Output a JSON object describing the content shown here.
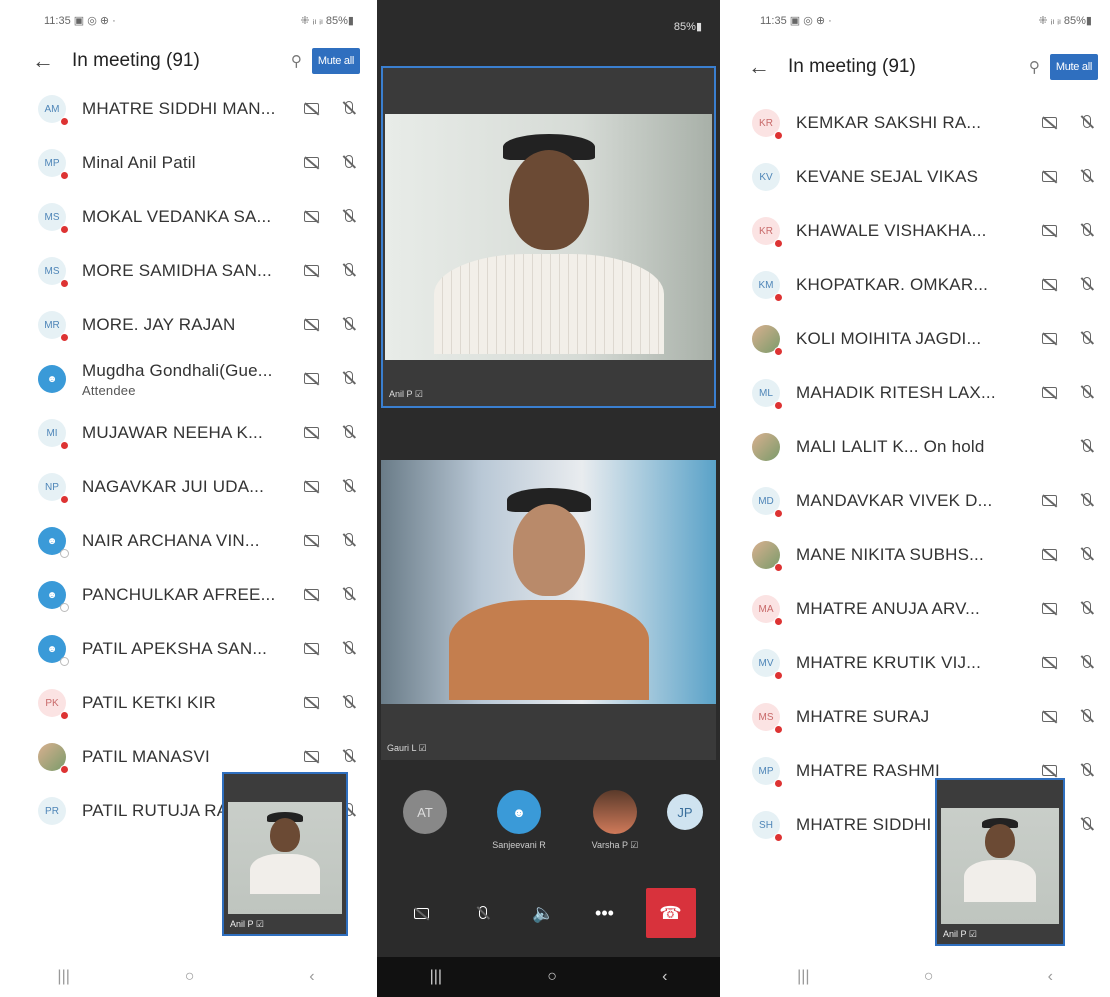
{
  "left": {
    "status": {
      "time": "11:35 ▣ ◎ ⊕ ·",
      "right": "⁜ ᵢₗ ᵢₗ 85%▮"
    },
    "header": {
      "back": "←",
      "title": "In meeting (91)",
      "mute_all": "Mute all"
    },
    "participants": [
      {
        "initials": "AM",
        "name": "MHATRE SIDDHI MAN...",
        "style": "",
        "dot": "red"
      },
      {
        "initials": "MP",
        "name": "Minal Anil Patil",
        "style": "",
        "dot": "red"
      },
      {
        "initials": "MS",
        "name": "MOKAL VEDANKA SA...",
        "style": "",
        "dot": "red"
      },
      {
        "initials": "MS",
        "name": "MORE SAMIDHA SAN...",
        "style": "",
        "dot": "red"
      },
      {
        "initials": "MR",
        "name": "MORE. JAY RAJAN",
        "style": "",
        "dot": "red"
      },
      {
        "initials": "",
        "name": "Mugdha Gondhali(Gue...",
        "sub": "Attendee",
        "style": "blue",
        "dot": ""
      },
      {
        "initials": "MI",
        "name": "MUJAWAR NEEHA K...",
        "style": "",
        "dot": "red"
      },
      {
        "initials": "NP",
        "name": "NAGAVKAR JUI UDA...",
        "style": "",
        "dot": "red"
      },
      {
        "initials": "",
        "name": "NAIR ARCHANA VIN...",
        "style": "blue",
        "dot": "hollow"
      },
      {
        "initials": "",
        "name": "PANCHULKAR AFREE...",
        "style": "blue",
        "dot": "hollow"
      },
      {
        "initials": "",
        "name": "PATIL APEKSHA SAN...",
        "style": "blue",
        "dot": "hollow"
      },
      {
        "initials": "PK",
        "name": "PATIL KETKI KIR",
        "style": "pink",
        "dot": "red"
      },
      {
        "initials": "",
        "name": "PATIL MANASVI",
        "style": "photo",
        "dot": "red"
      },
      {
        "initials": "PR",
        "name": "PATIL RUTUJA RAVI...",
        "style": "",
        "dot": ""
      }
    ],
    "pip_label": "Anil P ☑"
  },
  "middle": {
    "status": "85%▮",
    "video1_label": "Anil P ☑",
    "video2_label": "Gauri L ☑",
    "thumbs": [
      {
        "text": "AT",
        "label": ""
      },
      {
        "text": "",
        "label": "Sanjeevani R"
      },
      {
        "text": "",
        "label": "Varsha P ☑"
      },
      {
        "text": "JP",
        "label": ""
      }
    ],
    "controls": {
      "video": "◘",
      "mic": "🎙",
      "speaker": "🔈",
      "more": "•••",
      "hangup": "☎"
    }
  },
  "right": {
    "status": {
      "time": "11:35 ▣ ◎ ⊕ ·",
      "right": "⁜ ᵢₗ ᵢₗ 85%▮"
    },
    "header": {
      "back": "←",
      "title": "In meeting (91)",
      "mute_all": "Mute all"
    },
    "participants": [
      {
        "initials": "KR",
        "name": "KEMKAR SAKSHI RA...",
        "style": "pink",
        "dot": "red"
      },
      {
        "initials": "KV",
        "name": "KEVANE SEJAL VIKAS",
        "style": "",
        "dot": ""
      },
      {
        "initials": "KR",
        "name": "KHAWALE VISHAKHA...",
        "style": "pink",
        "dot": "red"
      },
      {
        "initials": "KM",
        "name": "KHOPATKAR. OMKAR...",
        "style": "",
        "dot": "red"
      },
      {
        "initials": "",
        "name": "KOLI MOIHITA JAGDI...",
        "style": "photo",
        "dot": "red"
      },
      {
        "initials": "ML",
        "name": "MAHADIK RITESH LAX...",
        "style": "",
        "dot": "red"
      },
      {
        "initials": "",
        "name": "MALI LALIT K...  On hold",
        "style": "photo",
        "dot": "",
        "hold": true
      },
      {
        "initials": "MD",
        "name": "MANDAVKAR VIVEK D...",
        "style": "",
        "dot": "red"
      },
      {
        "initials": "",
        "name": "MANE NIKITA SUBHS...",
        "style": "photo",
        "dot": "red"
      },
      {
        "initials": "MA",
        "name": "MHATRE ANUJA ARV...",
        "style": "pink",
        "dot": "red"
      },
      {
        "initials": "MV",
        "name": "MHATRE KRUTIK VIJ...",
        "style": "",
        "dot": "red"
      },
      {
        "initials": "MS",
        "name": "MHATRE SURAJ",
        "style": "pink",
        "dot": "red"
      },
      {
        "initials": "MP",
        "name": "MHATRE RASHMI",
        "style": "",
        "dot": "red"
      },
      {
        "initials": "SH",
        "name": "MHATRE SIDDHI MAN...",
        "style": "",
        "dot": "red"
      }
    ],
    "pip_label": "Anil P ☑"
  },
  "nav": {
    "recent": "|||",
    "home": "○",
    "back": "‹"
  }
}
